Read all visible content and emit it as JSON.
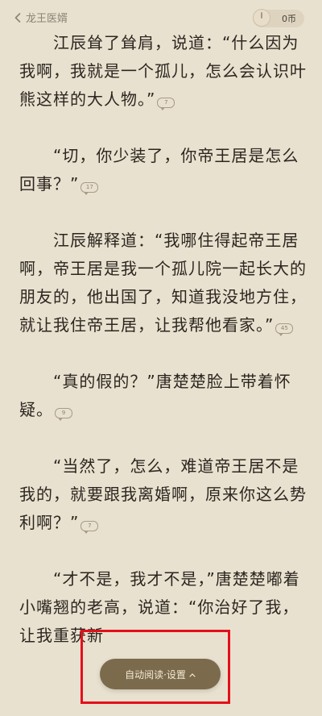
{
  "header": {
    "back_label": "龙王医婿",
    "coins_label": "0币",
    "back_icon": "chevron-left-icon",
    "coin_icon": "coin-dial-icon"
  },
  "content": {
    "paragraphs": [
      {
        "text": "江辰耸了耸肩，说道：“什么因为我啊，我就是一个孤儿，怎么会认识叶熊这样的大人物。”",
        "comments": "7"
      },
      {
        "text": "“切，你少装了，你帝王居是怎么回事？”",
        "comments": "17"
      },
      {
        "text": "江辰解释道：“我哪住得起帝王居啊，帝王居是我一个孤儿院一起长大的朋友的，他出国了，知道我没地方住，就让我住帝王居，让我帮他看家。”",
        "comments": "45"
      },
      {
        "text": "“真的假的？”唐楚楚脸上带着怀疑。",
        "comments": "9"
      },
      {
        "text": "“当然了，怎么，难道帝王居不是我的，就要跟我离婚啊，原来你这么势利啊？”",
        "comments": "7"
      },
      {
        "text": "“才不是，我才不是，”唐楚楚嘟着小嘴翘的老高，说道：“你治好了我，让我重获新",
        "comments": ""
      }
    ]
  },
  "bottom_bar": {
    "auto_read_label": "自动阅读·设置",
    "chevron_icon": "chevron-up-icon"
  },
  "annotation": {
    "color": "#e3101a"
  }
}
